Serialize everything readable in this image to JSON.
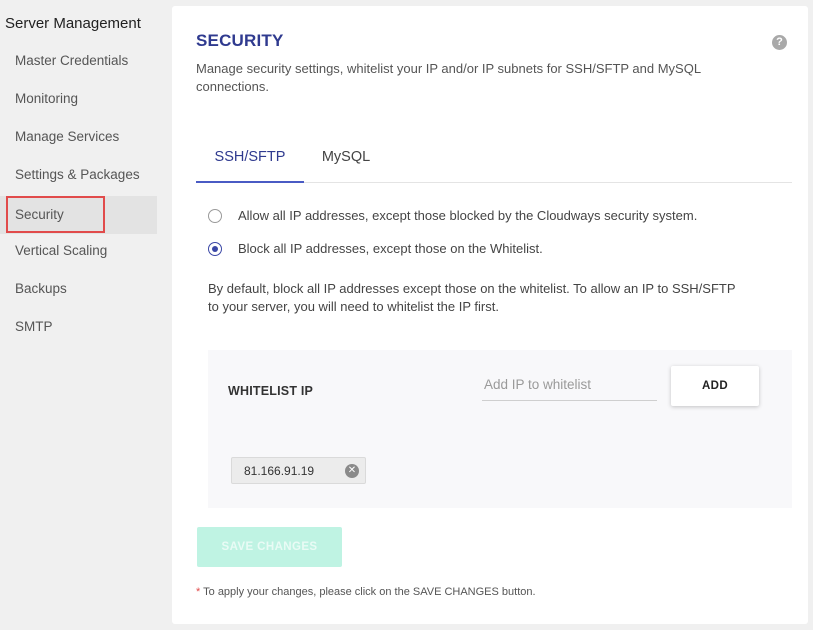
{
  "sidebar": {
    "title": "Server Management",
    "items": [
      {
        "label": "Master Credentials"
      },
      {
        "label": "Monitoring"
      },
      {
        "label": "Manage Services"
      },
      {
        "label": "Settings & Packages"
      },
      {
        "label": "Security",
        "active": true
      },
      {
        "label": "Vertical Scaling"
      },
      {
        "label": "Backups"
      },
      {
        "label": "SMTP"
      }
    ]
  },
  "main": {
    "title": "SECURITY",
    "help_icon": "?",
    "description": "Manage security settings, whitelist your IP and/or IP subnets for SSH/SFTP and MySQL connections.",
    "tabs": [
      {
        "label": "SSH/SFTP",
        "active": true
      },
      {
        "label": "MySQL",
        "active": false
      }
    ],
    "options": [
      {
        "label": "Allow all IP addresses, except those blocked by the Cloudways security system.",
        "checked": false
      },
      {
        "label": "Block all IP addresses, except those on the Whitelist.",
        "checked": true
      }
    ],
    "info": "By default, block all IP addresses except those on the whitelist. To allow an IP to SSH/SFTP to your server, you will need to whitelist the IP first.",
    "whitelist": {
      "label": "WHITELIST IP",
      "input_value": "",
      "input_placeholder": "Add IP to whitelist",
      "add_label": "ADD",
      "ips": [
        "81.166.91.19"
      ],
      "remove_icon": "close-circle-icon"
    },
    "save_label": "SAVE CHANGES",
    "footnote_star": "*",
    "footnote": " To apply your changes, please click on the SAVE CHANGES button."
  },
  "colors": {
    "accent": "#2f3a8f",
    "active_tab_underline": "#4a5bc4",
    "highlight_border": "#e14b4b",
    "save_disabled": "#bff3e3"
  }
}
